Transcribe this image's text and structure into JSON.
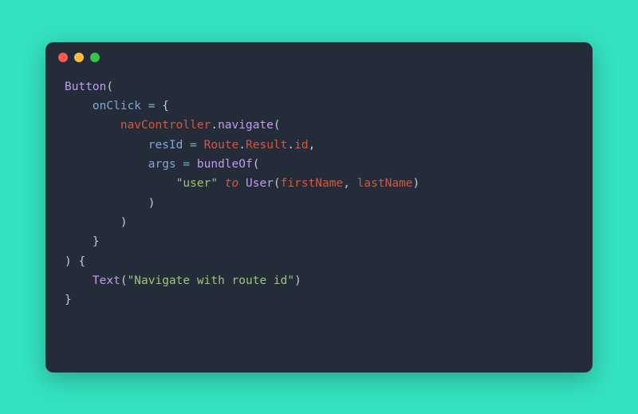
{
  "code": {
    "line1_fn": "Button",
    "line1_paren": "(",
    "line2_indent": "    ",
    "line2_prop": "onClick",
    "line2_eq": " = ",
    "line2_brace": "{",
    "line3_indent": "        ",
    "line3_id": "navController",
    "line3_dot": ".",
    "line3_method": "navigate",
    "line3_paren": "(",
    "line4_indent": "            ",
    "line4_prop": "resId",
    "line4_eq": " = ",
    "line4_route": "Route",
    "line4_dot1": ".",
    "line4_result": "Result",
    "line4_dot2": ".",
    "line4_id": "id",
    "line4_comma": ",",
    "line5_indent": "            ",
    "line5_prop": "args",
    "line5_eq": " = ",
    "line5_fn": "bundleOf",
    "line5_paren": "(",
    "line6_indent": "                ",
    "line6_str": "\"user\"",
    "line6_kw": " to ",
    "line6_user": "User",
    "line6_paren_open": "(",
    "line6_arg1": "firstName",
    "line6_comma": ", ",
    "line6_arg2": "lastName",
    "line6_paren_close": ")",
    "line7_indent": "            ",
    "line7_paren": ")",
    "line8_indent": "        ",
    "line8_paren": ")",
    "line9_indent": "    ",
    "line9_brace": "}",
    "line10_paren": ")",
    "line10_brace": " {",
    "line11_indent": "    ",
    "line11_fn": "Text",
    "line11_paren_open": "(",
    "line11_str": "\"Navigate with route id\"",
    "line11_paren_close": ")",
    "line12_brace": "}"
  }
}
